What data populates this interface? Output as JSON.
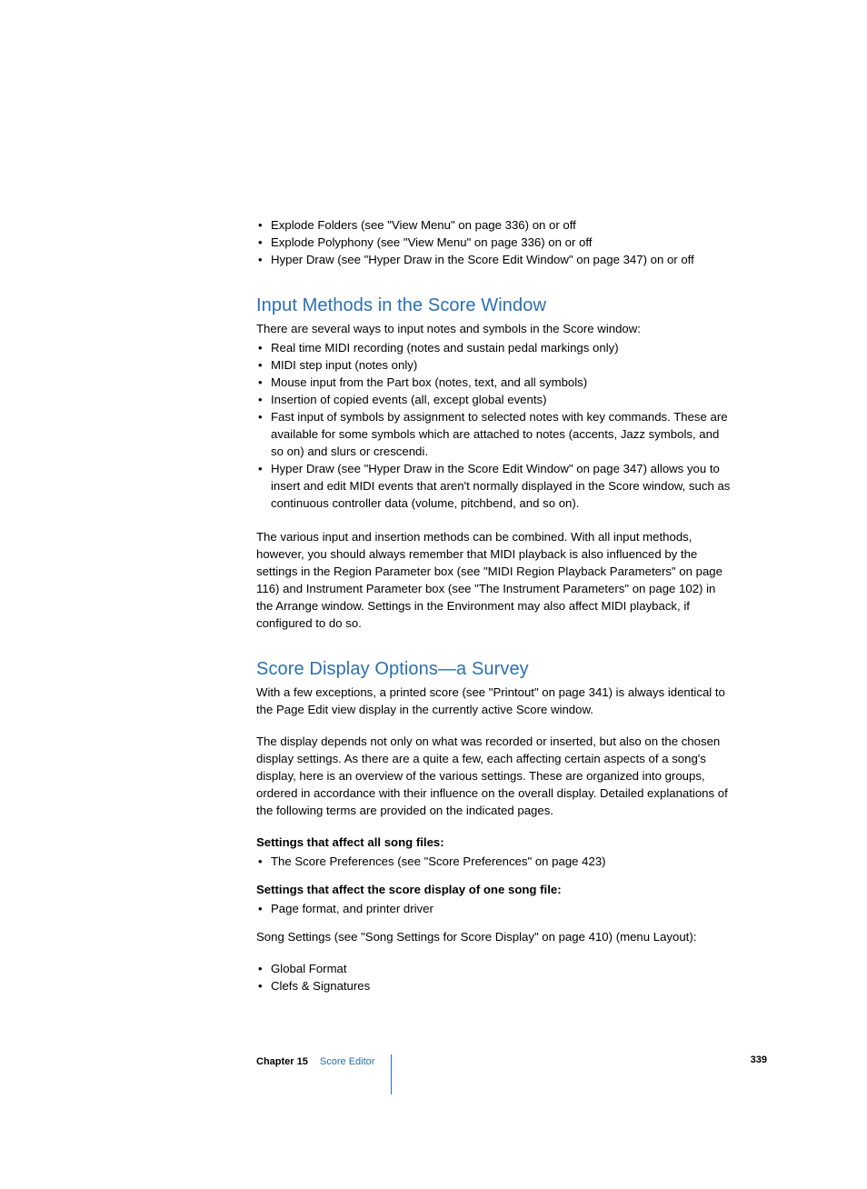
{
  "topList": [
    "Explode Folders (see \"View Menu\" on page 336) on or off",
    "Explode Polyphony (see \"View Menu\" on page 336) on or off",
    "Hyper Draw (see \"Hyper Draw in the Score Edit Window\" on page 347) on or off"
  ],
  "section1": {
    "heading": "Input Methods in the Score Window",
    "intro": "There are several ways to input notes and symbols in the Score window:",
    "list": [
      "Real time MIDI recording (notes and sustain pedal markings only)",
      "MIDI step input (notes only)",
      "Mouse input from the Part box (notes, text, and all symbols)",
      "Insertion of copied events (all, except global events)",
      "Fast input of symbols by assignment to selected notes with key commands. These are available for some symbols which are attached to notes (accents, Jazz symbols, and so on) and slurs or crescendi.",
      "Hyper Draw (see \"Hyper Draw in the Score Edit Window\" on page 347) allows you to insert and edit MIDI events that aren't normally displayed in the Score window, such as continuous controller data (volume, pitchbend, and so on)."
    ],
    "para": "The various input and insertion methods can be combined. With all input methods, however, you should always remember that MIDI playback is also influenced by the settings in the Region Parameter box (see \"MIDI Region Playback Parameters\" on page 116) and Instrument Parameter box (see \"The Instrument Parameters\" on page 102) in the Arrange window. Settings in the Environment may also affect MIDI playback, if configured to do so."
  },
  "section2": {
    "heading": "Score Display Options—a Survey",
    "para1": "With a few exceptions, a printed score (see \"Printout\" on page 341) is always identical to the Page Edit view display in the currently active Score window.",
    "para2": "The display depends not only on what was recorded or inserted, but also on the chosen display settings. As there are a quite a few, each affecting certain aspects of a song's display, here is an overview of the various settings. These are organized into groups, ordered in accordance with their influence on the overall display. Detailed explanations of the following terms are provided on the indicated pages.",
    "bold1": "Settings that affect all song files:",
    "list1": [
      "The Score Preferences (see \"Score Preferences\" on page 423)"
    ],
    "bold2": "Settings that affect the score display of one song file:",
    "list2": [
      "Page format, and printer driver"
    ],
    "para3": "Song Settings (see \"Song Settings for Score Display\" on page 410) (menu Layout):",
    "list3": [
      "Global Format",
      "Clefs & Signatures"
    ]
  },
  "footer": {
    "chapterLabel": "Chapter 15",
    "chapterName": "Score Editor",
    "pageNumber": "339"
  }
}
